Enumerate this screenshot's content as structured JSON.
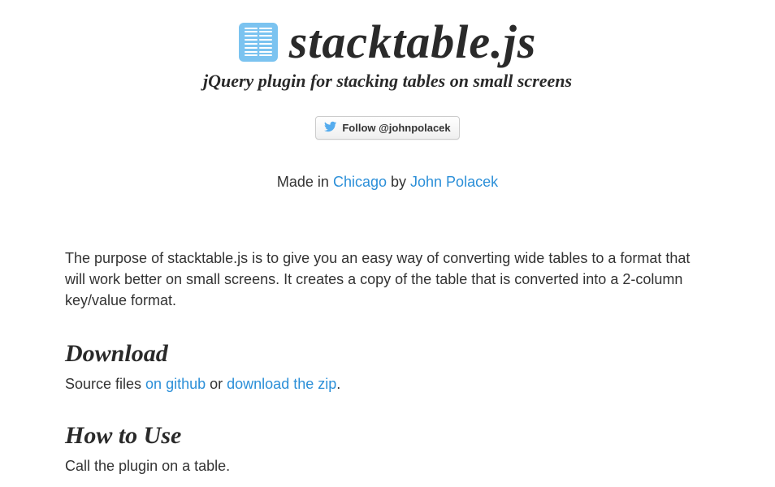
{
  "header": {
    "title": "stacktable.js",
    "subtitle": "jQuery plugin for stacking tables on small screens"
  },
  "follow": {
    "label": "Follow @johnpolacek"
  },
  "madein": {
    "prefix": "Made in ",
    "chicago": "Chicago",
    "by": " by ",
    "author": "John Polacek"
  },
  "intro": "The purpose of stacktable.js is to give you an easy way of converting wide tables to a format that will work better on small screens. It creates a copy of the table that is converted into a 2-column key/value format.",
  "download": {
    "heading": "Download",
    "prefix": "Source files ",
    "github": "on github",
    "or": " or ",
    "zip": "download the zip",
    "suffix": "."
  },
  "howto": {
    "heading": "How to Use",
    "text": "Call the plugin on a table."
  },
  "colors": {
    "link": "#2b8fd8",
    "logo": "#7bc3f0"
  }
}
